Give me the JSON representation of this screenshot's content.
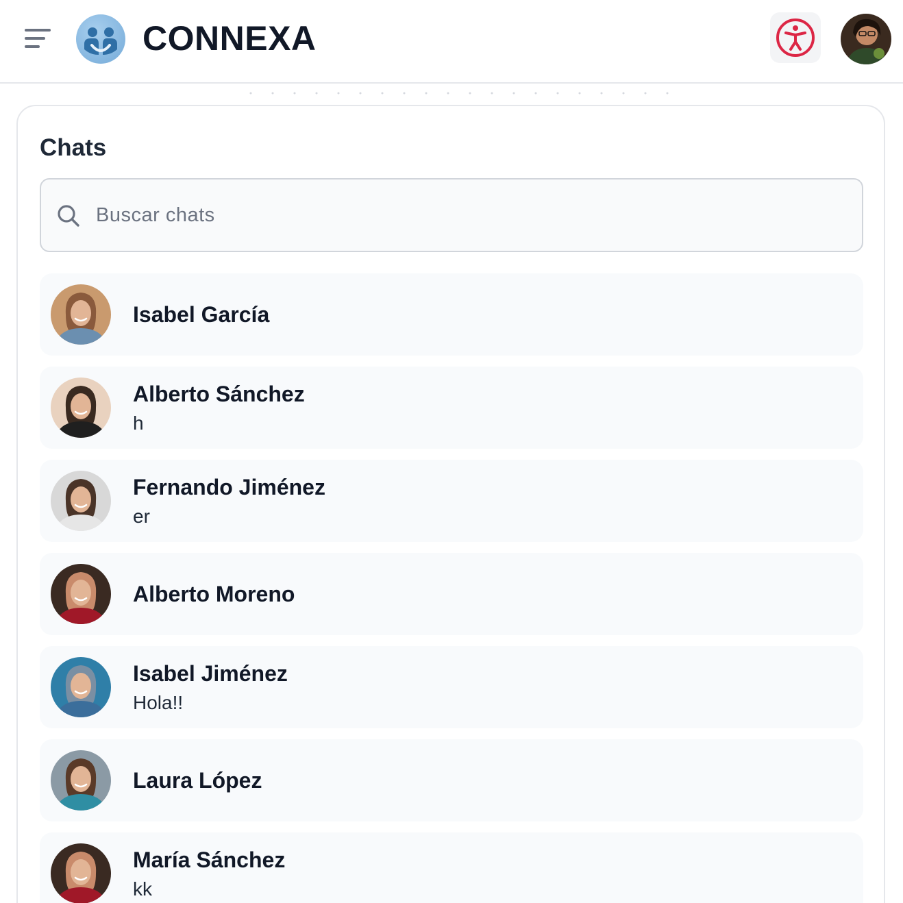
{
  "app": {
    "brand": "CONNEXA",
    "brand_color": "#3b82c4",
    "accent_color": "#dc2645"
  },
  "header": {
    "menu_icon": "hamburger-menu-icon",
    "accessibility_icon": "accessibility-icon",
    "user_avatar_icon": "user-avatar"
  },
  "chats": {
    "title": "Chats",
    "search_placeholder": "Buscar chats",
    "items": [
      {
        "name": "Isabel García",
        "message": "",
        "avatar_colors": [
          "#c99a6e",
          "#8a5a3c",
          "#6b8fb0"
        ]
      },
      {
        "name": "Alberto Sánchez",
        "message": "h",
        "avatar_colors": [
          "#e9d2bf",
          "#3a2a20",
          "#1f1f1f"
        ]
      },
      {
        "name": "Fernando Jiménez",
        "message": "er",
        "avatar_colors": [
          "#d8d8d8",
          "#4a3428",
          "#e6e6e6"
        ]
      },
      {
        "name": "Alberto Moreno",
        "message": "",
        "avatar_colors": [
          "#3a2a22",
          "#c98b6b",
          "#a01828"
        ]
      },
      {
        "name": "Isabel Jiménez",
        "message": "Hola!!",
        "avatar_colors": [
          "#2f7fa8",
          "#7a8fa3",
          "#3b6e9b"
        ]
      },
      {
        "name": "Laura López",
        "message": "",
        "avatar_colors": [
          "#8b9aa5",
          "#5a3a28",
          "#2f8ea3"
        ]
      },
      {
        "name": "María Sánchez",
        "message": "kk",
        "avatar_colors": [
          "#3a2a22",
          "#c98b6b",
          "#a01828"
        ]
      }
    ]
  }
}
